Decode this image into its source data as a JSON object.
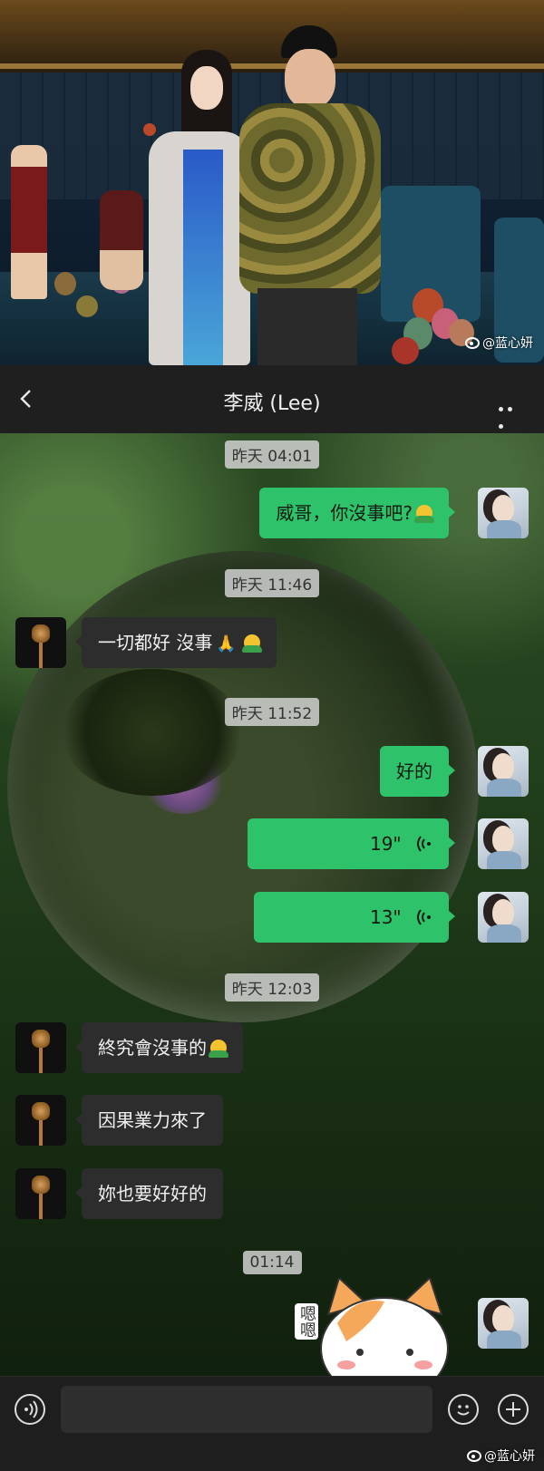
{
  "photo": {
    "watermark": "@蓝心妍"
  },
  "header": {
    "title": "李威 (Lee)"
  },
  "messages": [
    {
      "type": "time",
      "text": "昨天 04:01"
    },
    {
      "type": "out",
      "text": "威哥，你沒事吧?"
    },
    {
      "type": "time",
      "text": "昨天 11:46"
    },
    {
      "type": "in",
      "text": "一切都好 沒事"
    },
    {
      "type": "time",
      "text": "昨天 11:52"
    },
    {
      "type": "out",
      "text": "好的"
    },
    {
      "type": "voice",
      "text": "19\""
    },
    {
      "type": "voice",
      "text": "13\""
    },
    {
      "type": "time",
      "text": "昨天 12:03"
    },
    {
      "type": "in",
      "text": "終究會沒事的"
    },
    {
      "type": "in",
      "text": "因果業力來了"
    },
    {
      "type": "in",
      "text": "妳也要好好的"
    },
    {
      "type": "time",
      "text": "01:14"
    }
  ],
  "sticker": {
    "text": "嗯嗯"
  },
  "footer": {
    "watermark": "@蓝心妍"
  },
  "colors": {
    "outgoing_bubble": "#2ec36a",
    "incoming_bubble": "#2d2d2d"
  }
}
